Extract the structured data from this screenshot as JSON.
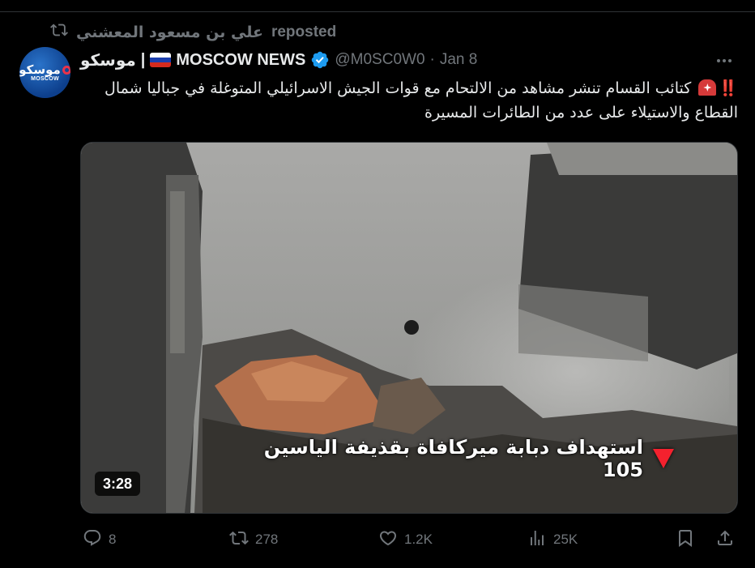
{
  "repost": {
    "user": "علي بن مسعود المعشني",
    "label": "reposted"
  },
  "author": {
    "avatar_text_ar": "موسكو",
    "avatar_text_en": "MOSCOW",
    "name_ar": "موسكو",
    "separator": "|",
    "name_en": "MOSCOW NEWS",
    "handle": "@M0SC0W0",
    "dot": "·",
    "date": "Jan 8"
  },
  "tweet": {
    "bangs": "‼️",
    "text": "كتائب القسام تنشر مشاهد من الالتحام مع قوات الجيش الاسرائيلي المتوغلة في جباليا شمال القطاع والاستيلاء على عدد من الطائرات المسيرة"
  },
  "media": {
    "caption": "استهداف دبابة ميركافاة بقذيفة الياسين 105",
    "duration": "3:28"
  },
  "actions": {
    "replies": "8",
    "reposts": "278",
    "likes": "1.2K",
    "views": "25K"
  },
  "icons": [
    "repost-icon",
    "verified-icon",
    "more-icon",
    "reply-icon",
    "like-icon",
    "views-icon",
    "bookmark-icon",
    "share-icon",
    "russia-flag-icon",
    "siren-icon"
  ],
  "colors": {
    "background": "#000000",
    "text": "#e7e9ea",
    "muted": "#71767b",
    "verified": "#1d9bf0",
    "alert": "#f4212e"
  }
}
